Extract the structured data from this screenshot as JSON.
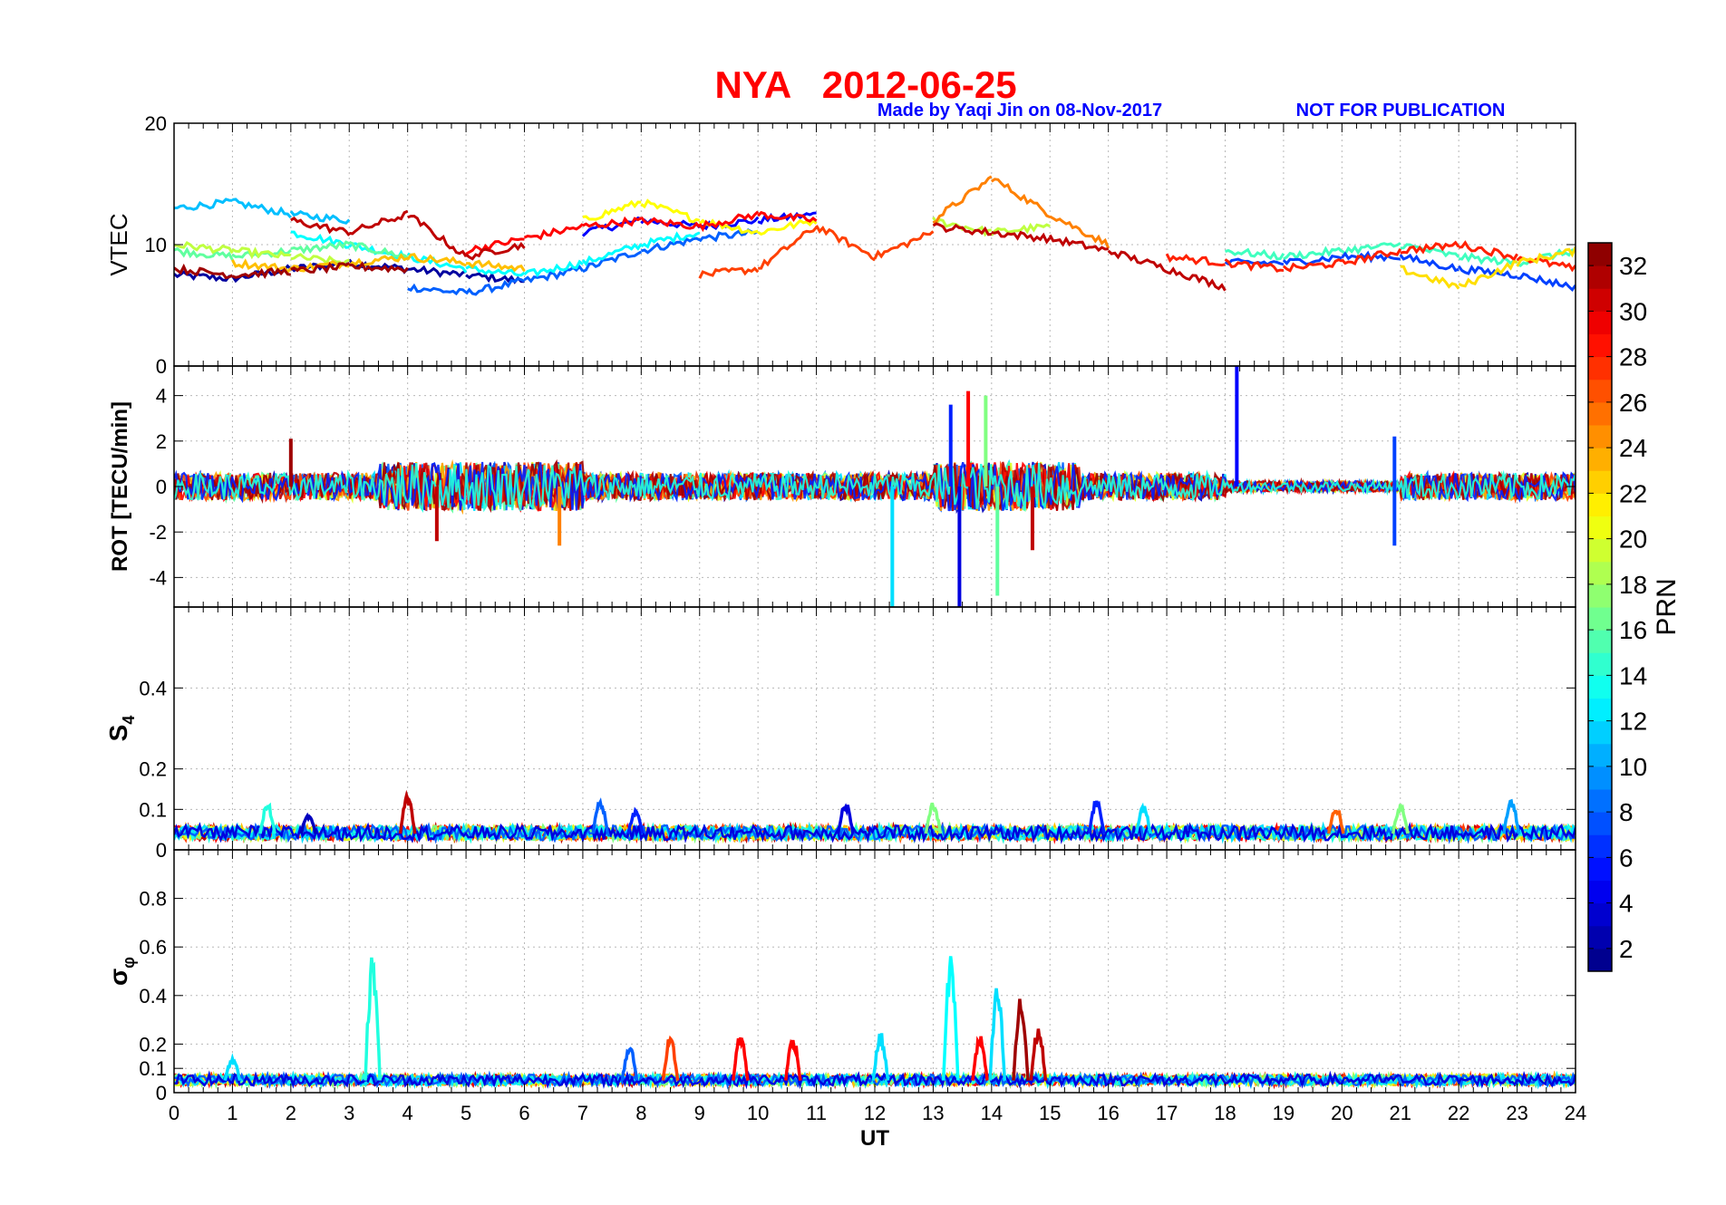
{
  "header": {
    "title": "NYA   2012-06-25",
    "credit": "Made by Yaqi Jin on 08-Nov-2017",
    "notice": "NOT FOR PUBLICATION",
    "title_color": "#ff0000",
    "credit_color": "#0000ff"
  },
  "colorbar": {
    "label": "PRN",
    "ticks": [
      "2",
      "4",
      "6",
      "8",
      "10",
      "12",
      "14",
      "16",
      "18",
      "20",
      "22",
      "24",
      "26",
      "28",
      "30",
      "32"
    ],
    "tick_values": [
      2,
      4,
      6,
      8,
      10,
      12,
      14,
      16,
      18,
      20,
      22,
      24,
      26,
      28,
      30,
      32
    ],
    "range": [
      1,
      33
    ],
    "colormap": "jet"
  },
  "chart_data": [
    {
      "type": "line",
      "panel": "vtec",
      "ylabel": "VTEC",
      "ylim": [
        0,
        20
      ],
      "yticks": [
        "0",
        "10",
        "20"
      ],
      "ytick_values": [
        0,
        10,
        20
      ],
      "xlim": [
        0,
        24
      ],
      "grid": true,
      "series": [
        {
          "prn": 2,
          "x": [
            0,
            1,
            2,
            3,
            4,
            5,
            6
          ],
          "y": [
            7.5,
            7.2,
            8.0,
            8.5,
            8.0,
            7.5,
            7.0
          ]
        },
        {
          "prn": 5,
          "x": [
            7,
            8,
            9,
            10,
            11
          ],
          "y": [
            11.0,
            12.0,
            11.5,
            12.0,
            12.5
          ]
        },
        {
          "prn": 8,
          "x": [
            4,
            5,
            6,
            7,
            8,
            9,
            10
          ],
          "y": [
            6.5,
            6.0,
            7.0,
            8.0,
            9.5,
            10.5,
            11.0
          ]
        },
        {
          "prn": 11,
          "x": [
            0,
            1,
            2,
            3
          ],
          "y": [
            13.0,
            13.5,
            12.5,
            12.0
          ]
        },
        {
          "prn": 13,
          "x": [
            2,
            3,
            4,
            5,
            6,
            7,
            8,
            9
          ],
          "y": [
            11.0,
            10.0,
            9.0,
            8.0,
            7.5,
            8.5,
            10.0,
            11.0
          ]
        },
        {
          "prn": 16,
          "x": [
            0,
            1,
            2,
            3,
            4
          ],
          "y": [
            9.5,
            9.0,
            9.5,
            10.0,
            9.0
          ]
        },
        {
          "prn": 19,
          "x": [
            0,
            1,
            2,
            3,
            13,
            14,
            15
          ],
          "y": [
            10.0,
            9.5,
            9.0,
            8.5,
            12.0,
            11.0,
            11.5
          ]
        },
        {
          "prn": 21,
          "x": [
            7,
            8,
            9,
            10,
            11
          ],
          "y": [
            12.0,
            13.5,
            12.0,
            11.0,
            12.0
          ]
        },
        {
          "prn": 23,
          "x": [
            1,
            2,
            3,
            4,
            5,
            6
          ],
          "y": [
            8.5,
            8.0,
            8.5,
            9.0,
            8.5,
            8.0
          ]
        },
        {
          "prn": 25,
          "x": [
            13,
            14,
            15,
            16
          ],
          "y": [
            12.0,
            15.5,
            12.5,
            10.0
          ]
        },
        {
          "prn": 27,
          "x": [
            9,
            10,
            11,
            12,
            13
          ],
          "y": [
            7.5,
            8.0,
            11.5,
            9.0,
            11.0
          ]
        },
        {
          "prn": 29,
          "x": [
            5,
            6,
            7,
            8,
            9,
            10,
            11
          ],
          "y": [
            9.5,
            10.5,
            11.5,
            12.0,
            11.5,
            12.5,
            12.0
          ]
        },
        {
          "prn": 31,
          "x": [
            2,
            3,
            4,
            5,
            6,
            13,
            14,
            15,
            16,
            17,
            18
          ],
          "y": [
            12.0,
            11.0,
            12.5,
            9.0,
            10.0,
            11.5,
            11.0,
            10.5,
            9.5,
            8.0,
            6.5
          ]
        },
        {
          "prn": 32,
          "x": [
            0,
            1,
            2,
            3,
            4
          ],
          "y": [
            8.0,
            7.5,
            7.8,
            8.2,
            8.0
          ]
        },
        {
          "prn": 15,
          "x": [
            18,
            19,
            20,
            21,
            22,
            23,
            24
          ],
          "y": [
            9.5,
            9.0,
            9.5,
            10.0,
            9.0,
            8.5,
            9.5
          ]
        },
        {
          "prn": 7,
          "x": [
            18,
            19,
            20,
            21,
            22,
            23,
            24
          ],
          "y": [
            8.5,
            8.5,
            9.0,
            9.0,
            8.0,
            7.5,
            6.5
          ]
        },
        {
          "prn": 28,
          "x": [
            17,
            18,
            19,
            20,
            21,
            22,
            23,
            24
          ],
          "y": [
            9.0,
            8.5,
            8.0,
            8.5,
            9.5,
            10.0,
            9.0,
            8.0
          ]
        },
        {
          "prn": 22,
          "x": [
            21,
            22,
            23,
            24
          ],
          "y": [
            8.0,
            6.5,
            8.5,
            9.5
          ]
        }
      ]
    },
    {
      "type": "line",
      "panel": "rot",
      "ylabel": "ROT [TECU/min]",
      "ylim": [
        -5.3,
        5.3
      ],
      "yticks": [
        "-4",
        "-2",
        "0",
        "2",
        "4"
      ],
      "ytick_values": [
        -4,
        -2,
        0,
        2,
        4
      ],
      "xlim": [
        0,
        24
      ],
      "grid": true,
      "noise_amplitude": 0.6,
      "spikes": [
        {
          "x": 12.3,
          "y": -5.3,
          "prn": 12
        },
        {
          "x": 13.3,
          "y": 3.6,
          "prn": 6
        },
        {
          "x": 13.45,
          "y": -5.3,
          "prn": 4
        },
        {
          "x": 13.6,
          "y": 4.2,
          "prn": 29
        },
        {
          "x": 13.9,
          "y": 4.0,
          "prn": 17
        },
        {
          "x": 14.1,
          "y": -4.8,
          "prn": 16
        },
        {
          "x": 18.2,
          "y": 5.3,
          "prn": 5
        },
        {
          "x": 20.9,
          "y": 2.2,
          "prn": 7
        },
        {
          "x": 20.9,
          "y": -2.6,
          "prn": 7
        },
        {
          "x": 6.6,
          "y": -2.6,
          "prn": 25
        },
        {
          "x": 4.5,
          "y": -2.4,
          "prn": 31
        },
        {
          "x": 2.0,
          "y": 2.1,
          "prn": 32
        },
        {
          "x": 14.7,
          "y": -2.8,
          "prn": 31
        }
      ]
    },
    {
      "type": "line",
      "panel": "s4",
      "ylabel": "S",
      "ylabel_sub": "4",
      "ylim": [
        0,
        0.6
      ],
      "yticks": [
        "0",
        "0.1",
        "0.2",
        "0.4"
      ],
      "ytick_values": [
        0,
        0.1,
        0.2,
        0.4
      ],
      "xlim": [
        0,
        24
      ],
      "grid": true,
      "baseline": 0.04,
      "bumps": [
        {
          "x": 4.0,
          "y": 0.14,
          "prn": 31
        },
        {
          "x": 7.3,
          "y": 0.13,
          "prn": 8
        },
        {
          "x": 7.9,
          "y": 0.1,
          "prn": 6
        },
        {
          "x": 11.5,
          "y": 0.12,
          "prn": 4
        },
        {
          "x": 13.0,
          "y": 0.12,
          "prn": 17
        },
        {
          "x": 15.8,
          "y": 0.13,
          "prn": 6
        },
        {
          "x": 16.6,
          "y": 0.11,
          "prn": 12
        },
        {
          "x": 19.9,
          "y": 0.11,
          "prn": 26
        },
        {
          "x": 21.0,
          "y": 0.12,
          "prn": 17
        },
        {
          "x": 22.9,
          "y": 0.13,
          "prn": 10
        },
        {
          "x": 1.6,
          "y": 0.12,
          "prn": 14
        },
        {
          "x": 2.3,
          "y": 0.09,
          "prn": 3
        }
      ]
    },
    {
      "type": "line",
      "panel": "sigma_phi",
      "ylabel": "σ",
      "ylabel_sub": "φ",
      "xlabel": "UT",
      "ylim": [
        0,
        1.0
      ],
      "yticks": [
        "0",
        "0.1",
        "0.2",
        "0.4",
        "0.6",
        "0.8"
      ],
      "ytick_values": [
        0,
        0.1,
        0.2,
        0.4,
        0.6,
        0.8
      ],
      "xticks": [
        "0",
        "1",
        "2",
        "3",
        "4",
        "5",
        "6",
        "7",
        "8",
        "9",
        "10",
        "11",
        "12",
        "13",
        "14",
        "15",
        "16",
        "17",
        "18",
        "19",
        "20",
        "21",
        "22",
        "23",
        "24"
      ],
      "xtick_values": [
        0,
        1,
        2,
        3,
        4,
        5,
        6,
        7,
        8,
        9,
        10,
        11,
        12,
        13,
        14,
        15,
        16,
        17,
        18,
        19,
        20,
        21,
        22,
        23,
        24
      ],
      "xlim": [
        0,
        24
      ],
      "grid": true,
      "baseline": 0.05,
      "bumps": [
        {
          "x": 3.4,
          "y": 0.59,
          "prn": 14
        },
        {
          "x": 8.5,
          "y": 0.24,
          "prn": 27
        },
        {
          "x": 9.7,
          "y": 0.25,
          "prn": 29
        },
        {
          "x": 10.6,
          "y": 0.24,
          "prn": 29
        },
        {
          "x": 12.1,
          "y": 0.25,
          "prn": 12
        },
        {
          "x": 13.3,
          "y": 0.58,
          "prn": 13
        },
        {
          "x": 13.8,
          "y": 0.24,
          "prn": 29
        },
        {
          "x": 14.1,
          "y": 0.45,
          "prn": 12
        },
        {
          "x": 14.5,
          "y": 0.4,
          "prn": 32
        },
        {
          "x": 14.8,
          "y": 0.28,
          "prn": 31
        },
        {
          "x": 7.8,
          "y": 0.2,
          "prn": 8
        },
        {
          "x": 1.0,
          "y": 0.15,
          "prn": 12
        }
      ]
    }
  ]
}
